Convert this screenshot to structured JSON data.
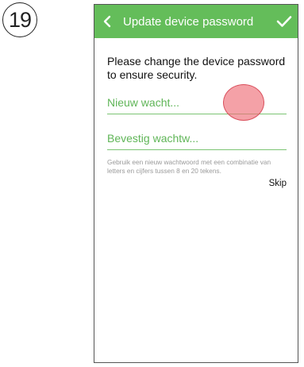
{
  "step": {
    "number": "19"
  },
  "nav": {
    "title": "Update device password",
    "back_icon": "chevron-left-icon",
    "confirm_icon": "checkmark-icon",
    "background_color": "#64bd5a"
  },
  "form": {
    "message": "Please change the device password to ensure security.",
    "new_password_placeholder": "Nieuw wacht...",
    "confirm_password_placeholder": "Bevestig wachtw...",
    "hint": "Gebruik een nieuw wachtwoord met een combinatie van letters en cijfers tussen 8 en 20 tekens.",
    "skip_label": "Skip"
  },
  "colors": {
    "accent": "#64bd5a",
    "touch_indicator": "#ee6e78"
  }
}
